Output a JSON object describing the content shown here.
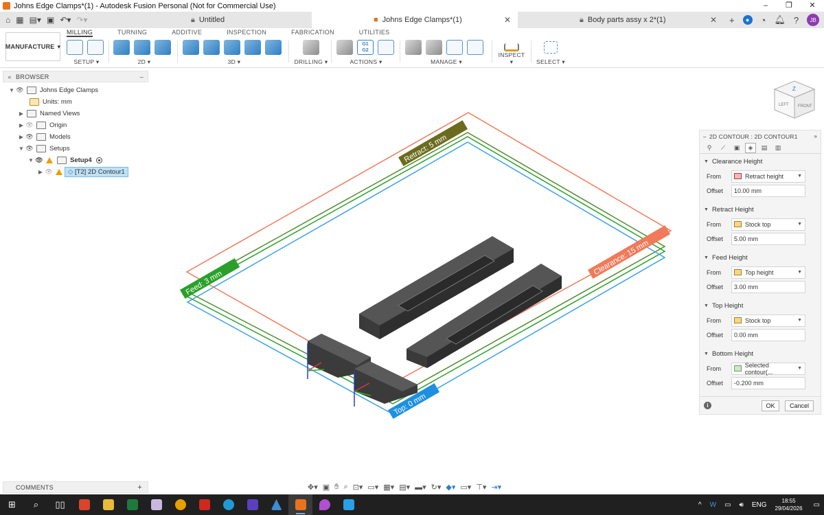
{
  "window": {
    "title": "Johns Edge Clamps*(1) - Autodesk Fusion Personal (Not for Commercial Use)",
    "controls": [
      "–",
      "❐",
      "✕"
    ]
  },
  "tabs": [
    {
      "label": "Untitled",
      "icon": "lock-icon"
    },
    {
      "label": "Johns Edge Clamps*(1)",
      "icon": "box-icon"
    },
    {
      "label": "Body parts assy x 2*(1)",
      "icon": "lock-icon"
    }
  ],
  "user": {
    "initials": "JB"
  },
  "ribbon": {
    "workspace": "MANUFACTURE",
    "tabs": [
      "MILLING",
      "TURNING",
      "ADDITIVE",
      "INSPECTION",
      "FABRICATION",
      "UTILITIES"
    ],
    "groups": {
      "setup": "SETUP",
      "twod": "2D",
      "threed": "3D",
      "drilling": "DRILLING",
      "actions": "ACTIONS",
      "manage": "MANAGE",
      "inspect": "INSPECT",
      "select": "SELECT"
    },
    "g1g2": "G1\nG2"
  },
  "browser": {
    "title": "BROWSER",
    "root": "Johns Edge Clamps",
    "units": "Units: mm",
    "named_views": "Named Views",
    "origin": "Origin",
    "models": "Models",
    "setups": "Setups",
    "setup4": "Setup4",
    "operation": "[T2] 2D Contour1"
  },
  "viewport_labels": {
    "retract": "Retract: 5 mm",
    "clearance": "Clearance: 15 mm",
    "feed": "Feed: 3 mm",
    "top": "Top: 0 mm"
  },
  "viewcube": {
    "left": "LEFT",
    "front": "FRONT",
    "axis": "Z"
  },
  "op_panel": {
    "title": "2D CONTOUR : 2D CONTOUR1",
    "from_label": "From",
    "offset_label": "Offset",
    "sections": {
      "clearance": {
        "title": "Clearance Height",
        "from": "Retract height",
        "offset": "10.00 mm"
      },
      "retract": {
        "title": "Retract Height",
        "from": "Stock top",
        "offset": "5.00 mm"
      },
      "feed": {
        "title": "Feed Height",
        "from": "Top height",
        "offset": "3.00 mm"
      },
      "top": {
        "title": "Top Height",
        "from": "Stock top",
        "offset": "0.00 mm"
      },
      "bottom": {
        "title": "Bottom Height",
        "from": "Selected contour(...",
        "offset": "-0.200 mm"
      }
    },
    "ok": "OK",
    "cancel": "Cancel"
  },
  "comments": {
    "title": "COMMENTS"
  },
  "taskbar": {
    "lang": "ENG",
    "time": "18:55",
    "date": "29/04/2026"
  },
  "colors": {
    "clearance_plane": "#f07a5a",
    "retract_plane": "#6b6b1e",
    "feed_plane": "#2aa02a",
    "top_plane": "#1e90e0",
    "part": "#3b3b3b"
  }
}
